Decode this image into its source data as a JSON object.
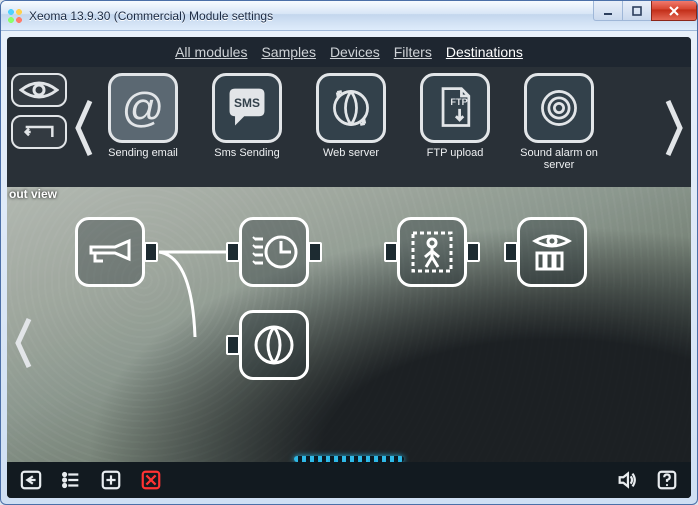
{
  "window": {
    "title": "Xeoma 13.9.30 (Commercial) Module settings"
  },
  "tabs": {
    "all": "All modules",
    "samples": "Samples",
    "devices": "Devices",
    "filters": "Filters",
    "destinations": "Destinations",
    "active": "destinations"
  },
  "modules": [
    {
      "id": "sending-email",
      "label": "Sending email",
      "icon": "at-icon",
      "selected": true
    },
    {
      "id": "sms-sending",
      "label": "Sms Sending",
      "icon": "sms-icon",
      "selected": false
    },
    {
      "id": "web-server",
      "label": "Web server",
      "icon": "globe-arrows-icon",
      "selected": false
    },
    {
      "id": "ftp-upload",
      "label": "FTP upload",
      "icon": "ftp-page-icon",
      "selected": false
    },
    {
      "id": "sound-alarm",
      "label": "Sound alarm on server",
      "icon": "speaker-rings-icon",
      "selected": false
    }
  ],
  "canvas": {
    "overlay_text": "out view",
    "nodes": [
      {
        "id": "camera",
        "icon": "camera-icon"
      },
      {
        "id": "scheduler",
        "icon": "scheduler-icon"
      },
      {
        "id": "motion",
        "icon": "motion-icon"
      },
      {
        "id": "archive",
        "icon": "archive-icon"
      },
      {
        "id": "web-server-node",
        "icon": "globe-arrows-icon"
      }
    ]
  },
  "icons": {
    "eye-icon": "eye",
    "back-wide-icon": "back",
    "chevron-left-icon": "chevron-left",
    "chevron-right-icon": "chevron-right",
    "arrow-back-icon": "arrow-back",
    "list-icon": "list",
    "plus-icon": "plus",
    "x-icon": "x",
    "sound-icon": "sound",
    "help-icon": "help"
  }
}
